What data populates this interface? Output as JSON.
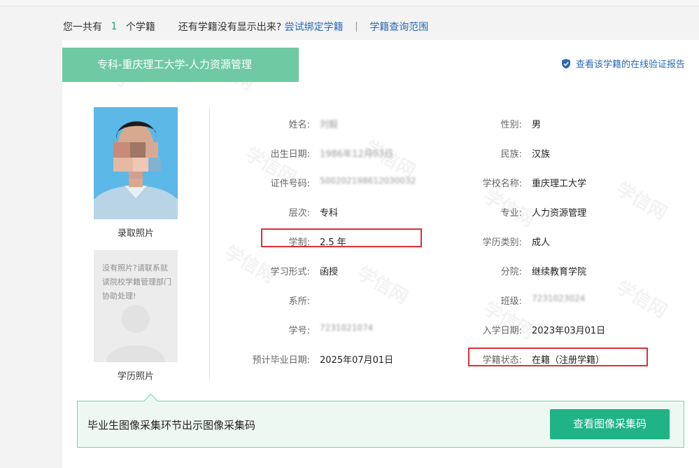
{
  "summary": {
    "prefix": "您一共有",
    "count": "1",
    "suffix": "个学籍",
    "question": "还有学籍没有显示出来?",
    "bind_link": "尝试绑定学籍",
    "separator": "|",
    "scope_link": "学籍查询范围"
  },
  "record": {
    "title": "专科-重庆理工大学-人力资源管理",
    "verify_link": "查看该学籍的在线验证报告",
    "photo_admission_label": "录取照片",
    "photo_degree_note": "没有照片?请联系就读院校学籍管理部门协助处理!",
    "photo_degree_label": "学历照片"
  },
  "fields_left": [
    {
      "label": "姓名:",
      "value": "刘毅"
    },
    {
      "label": "出生日期:",
      "value": "1986年12月03日"
    },
    {
      "label": "证件号码:",
      "value": "500202198612030032"
    },
    {
      "label": "层次:",
      "value": "专科"
    },
    {
      "label": "学制:",
      "value": "2.5 年"
    },
    {
      "label": "学习形式:",
      "value": "函授"
    },
    {
      "label": "系所:",
      "value": ""
    },
    {
      "label": "学号:",
      "value": "7231021074"
    },
    {
      "label": "预计毕业日期:",
      "value": "2025年07月01日"
    }
  ],
  "fields_right": [
    {
      "label": "性别:",
      "value": "男"
    },
    {
      "label": "民族:",
      "value": "汉族"
    },
    {
      "label": "学校名称:",
      "value": "重庆理工大学"
    },
    {
      "label": "专业:",
      "value": "人力资源管理"
    },
    {
      "label": "学历类别:",
      "value": "成人"
    },
    {
      "label": "分院:",
      "value": "继续教育学院"
    },
    {
      "label": "班级:",
      "value": "7231023024"
    },
    {
      "label": "入学日期:",
      "value": "2023年03月01日"
    },
    {
      "label": "学籍状态:",
      "value": "在籍（注册学籍）"
    }
  ],
  "notice": {
    "text": "毕业生图像采集环节出示图像采集码",
    "button": "查看图像采集码"
  },
  "watermark": "学信网",
  "colors": {
    "accent_green": "#1fb386",
    "header_green": "#6fcaa3",
    "link_blue": "#2a6bb3",
    "highlight_red": "#d9303a"
  }
}
